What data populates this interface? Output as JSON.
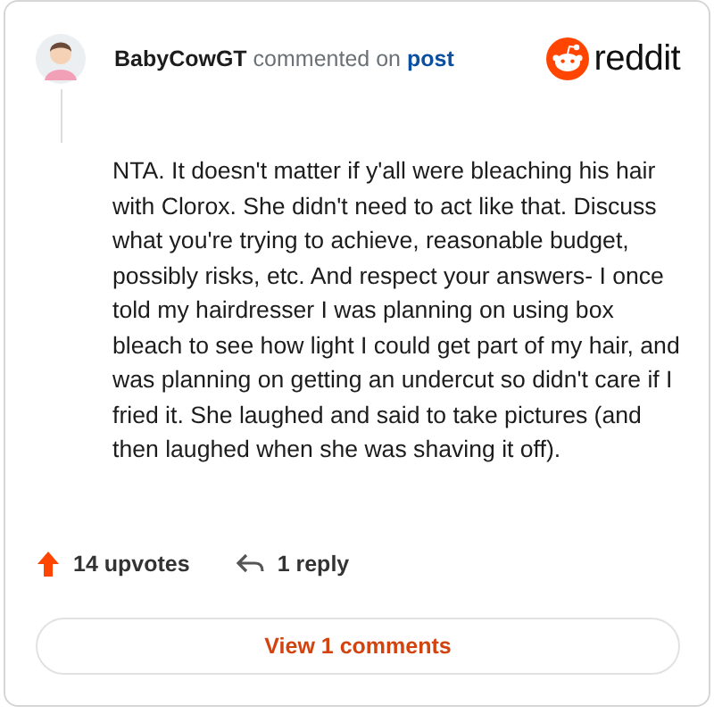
{
  "header": {
    "username": "BabyCowGT",
    "action": "commented on",
    "link": "post",
    "brand": "reddit"
  },
  "comment": {
    "body": "NTA. It doesn't matter if y'all were bleaching his hair with Clorox. She didn't need to act like that. Discuss what you're trying to achieve, reasonable budget, possibly risks, etc. And respect your answers- I once told my hairdresser I was planning on using box bleach to see how light I could get part of my hair, and was planning on getting an undercut so didn't care if I fried it. She laughed and said to take pictures (and then laughed when she was shaving it off)."
  },
  "actions": {
    "upvotes": "14 upvotes",
    "replies": "1 reply"
  },
  "button": "View 1 comments"
}
